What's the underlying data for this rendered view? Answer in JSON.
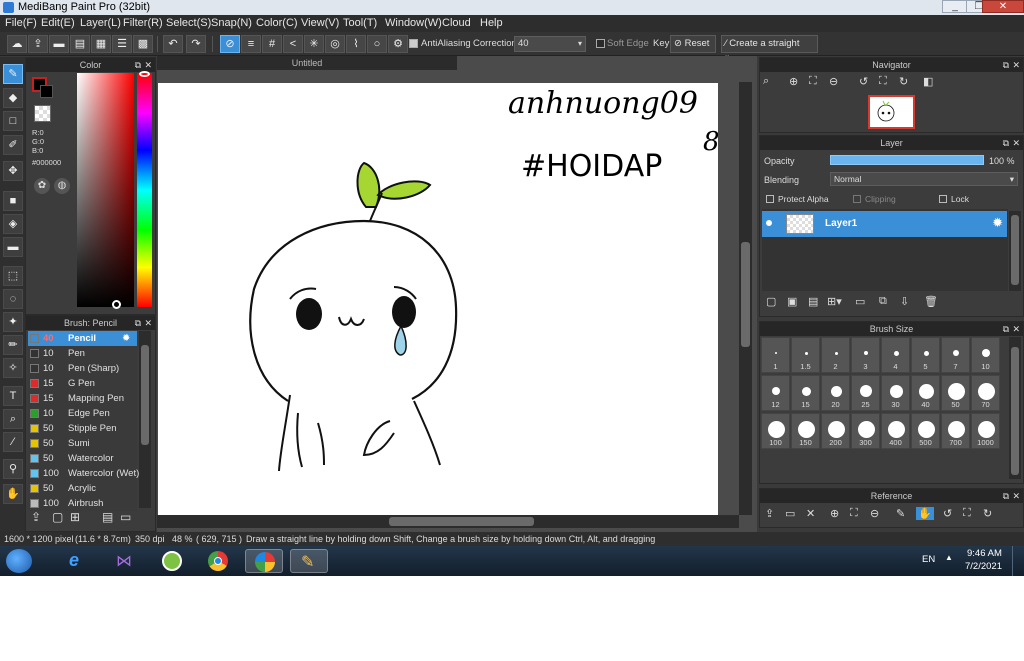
{
  "window": {
    "title": "MediBang Paint Pro (32bit)",
    "min": "_",
    "max": "❐",
    "close": "✕"
  },
  "menu": [
    "File(F)",
    "Edit(E)",
    "Layer(L)",
    "Filter(R)",
    "Select(S)",
    "Snap(N)",
    "Color(C)",
    "View(V)",
    "Tool(T)",
    "Window(W)",
    "Cloud",
    "Help"
  ],
  "toolbar": {
    "antialiasing": "AntiAliasing",
    "correction_label": "Correction",
    "correction_value": "40",
    "soft_edge": "Soft Edge",
    "key_label": "Key",
    "reset_label": "Reset",
    "straight_line": "Create a straight line"
  },
  "color_panel": {
    "title": "Color",
    "r": "R:0",
    "g": "G:0",
    "b": "B:0",
    "hex": "#000000",
    "fg": "#000000",
    "bg": "#ffffff"
  },
  "brush_panel": {
    "title": "Brush: Pencil",
    "items": [
      {
        "size": "40",
        "name": "Pencil",
        "color": "#3b8fd6"
      },
      {
        "size": "10",
        "name": "Pen",
        "color": "#333333"
      },
      {
        "size": "10",
        "name": "Pen (Sharp)",
        "color": "#333333"
      },
      {
        "size": "15",
        "name": "G Pen",
        "color": "#e02a2a"
      },
      {
        "size": "15",
        "name": "Mapping Pen",
        "color": "#e02a2a"
      },
      {
        "size": "10",
        "name": "Edge Pen",
        "color": "#2aa02a"
      },
      {
        "size": "50",
        "name": "Stipple Pen",
        "color": "#e6c300"
      },
      {
        "size": "50",
        "name": "Sumi",
        "color": "#e6c300"
      },
      {
        "size": "50",
        "name": "Watercolor",
        "color": "#5fc4f0"
      },
      {
        "size": "100",
        "name": "Watercolor (Wet)",
        "color": "#5fc4f0"
      },
      {
        "size": "50",
        "name": "Acrylic",
        "color": "#e6c300"
      },
      {
        "size": "100",
        "name": "Airbrush",
        "color": "#bbbbbb"
      }
    ]
  },
  "document": {
    "tab": "Untitled",
    "handwriting_line1": "anhnuong09",
    "handwriting_line2": "#HOIDAP",
    "handwriting_extra": "8"
  },
  "navigator": {
    "title": "Navigator"
  },
  "layer_panel": {
    "title": "Layer",
    "opacity_label": "Opacity",
    "opacity_value": "100 %",
    "opacity_fraction": 1.0,
    "blending_label": "Blending",
    "blending_value": "Normal",
    "protect_alpha": "Protect Alpha",
    "clipping": "Clipping",
    "lock": "Lock",
    "layer_name": "Layer1"
  },
  "brush_size": {
    "title": "Brush Size",
    "sizes": [
      "1",
      "1.5",
      "2",
      "3",
      "4",
      "5",
      "7",
      "10",
      "12",
      "15",
      "20",
      "25",
      "30",
      "40",
      "50",
      "70",
      "100",
      "150",
      "200",
      "300",
      "400",
      "500",
      "700",
      "1000"
    ]
  },
  "reference": {
    "title": "Reference"
  },
  "status": {
    "dimensions": "1600 * 1200 pixel",
    "physical": "(11.6 * 8.7cm)",
    "dpi": "350 dpi",
    "zoom": "48 %",
    "coords": "( 629, 715 )",
    "hint": "Draw a straight line by holding down Shift, Change a brush size by holding down Ctrl, Alt, and dragging"
  },
  "taskbar": {
    "lang": "EN",
    "time": "9:46 AM",
    "date": "7/2/2021"
  }
}
